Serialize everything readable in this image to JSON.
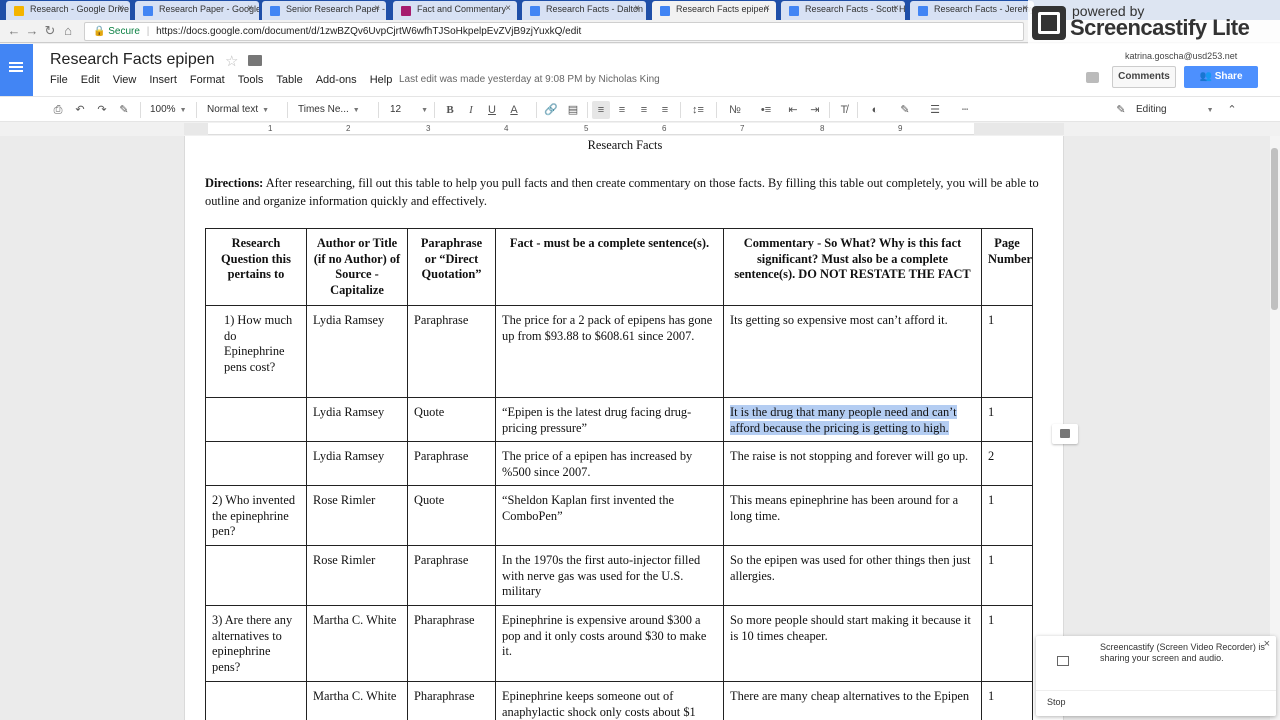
{
  "browser": {
    "tabs": [
      {
        "label": "Research - Google Drive",
        "color": "#f4b400"
      },
      {
        "label": "Research Paper - Google",
        "color": "#4285f4"
      },
      {
        "label": "Senior Research Paper -",
        "color": "#4285f4"
      },
      {
        "label": "Fact and Commentary",
        "color": "#a61c6e"
      },
      {
        "label": "Research Facts - Dalton",
        "color": "#4285f4"
      },
      {
        "label": "Research Facts epipen",
        "color": "#4285f4"
      },
      {
        "label": "Research Facts - Scott H",
        "color": "#4285f4"
      },
      {
        "label": "Research Facts - Jeremy",
        "color": "#4285f4"
      }
    ],
    "tab_close": "×",
    "secure_label": "Secure",
    "url": "https://docs.google.com/document/d/1zwBZQv6UvpCjrtW6wfhTJSoHkpelpEvZVjB9zjYuxkQ/edit"
  },
  "watermark": {
    "line1": "powered by",
    "line2": "Screencastify Lite"
  },
  "docs": {
    "title": "Research Facts epipen",
    "menu": [
      "File",
      "Edit",
      "View",
      "Insert",
      "Format",
      "Tools",
      "Table",
      "Add-ons",
      "Help"
    ],
    "last_edit": "Last edit was made yesterday at 9:08 PM by Nicholas King",
    "user_email": "katrina.goscha@usd253.net",
    "comments_label": "Comments",
    "share_label": "Share",
    "toolbar": {
      "zoom": "100%",
      "style": "Normal text",
      "font": "Times Ne...",
      "size": "12",
      "mode": "Editing"
    },
    "ruler": [
      "1",
      "2",
      "3",
      "4",
      "5",
      "6",
      "7",
      "8",
      "9"
    ]
  },
  "document": {
    "heading": "Research Facts",
    "directions_label": "Directions:",
    "directions_text": " After researching, fill out this table to help you pull facts and then create commentary on those facts. By filling this table out completely, you will be able to outline and organize information quickly and effectively.",
    "headers": [
      "Research Question this pertains to",
      "Author or Title (if no Author) of Source - Capitalize",
      "Paraphrase or “Direct Quotation”",
      "Fact - must be a complete sentence(s).",
      "Commentary - So What? Why is this fact significant? Must also be a complete sentence(s). DO NOT RESTATE THE FACT",
      "Page Number"
    ],
    "rows": [
      [
        "1) How much do Epinephrine pens cost?",
        "Lydia Ramsey",
        "Paraphrase",
        "The price for a 2 pack of epipens has gone up from $93.88 to $608.61 since 2007.",
        "Its getting so expensive most can’t afford it.",
        "1"
      ],
      [
        "",
        "Lydia Ramsey",
        "Quote",
        "“Epipen is the latest drug facing drug-pricing pressure”",
        "It is the drug that many people need and can’t afford because the pricing is getting to high.",
        "1"
      ],
      [
        "",
        "Lydia Ramsey",
        "Paraphrase",
        "The price of a epipen has increased by %500 since 2007.",
        "The raise is not stopping and forever will go up.",
        "2"
      ],
      [
        "2) Who invented the epinephrine pen?",
        "Rose Rimler",
        " Quote",
        "“Sheldon Kaplan first invented the ComboPen”",
        "This means epinephrine has been around for a long time.",
        "1"
      ],
      [
        "",
        "Rose Rimler",
        "Paraphrase",
        "In the 1970s the first auto-injector filled with nerve gas was used for the U.S. military",
        "So the epipen was used for other things then just allergies.",
        "1"
      ],
      [
        "3) Are there any alternatives to epinephrine pens?",
        "Martha C. White",
        "Pharaphrase",
        "Epinephrine is expensive around $300 a pop and it only costs around $30 to make it.",
        "So more people should start making it because it is 10 times cheaper.",
        "1"
      ],
      [
        "",
        "Martha C. White",
        "Pharaphrase",
        "Epinephrine keeps someone out of anaphylactic shock only costs about $1",
        "There are many cheap alternatives to the Epipen",
        "1"
      ]
    ]
  },
  "notification": {
    "text": "Screencastify (Screen Video Recorder) is sharing your screen and audio.",
    "stop": "Stop",
    "close": "×"
  }
}
